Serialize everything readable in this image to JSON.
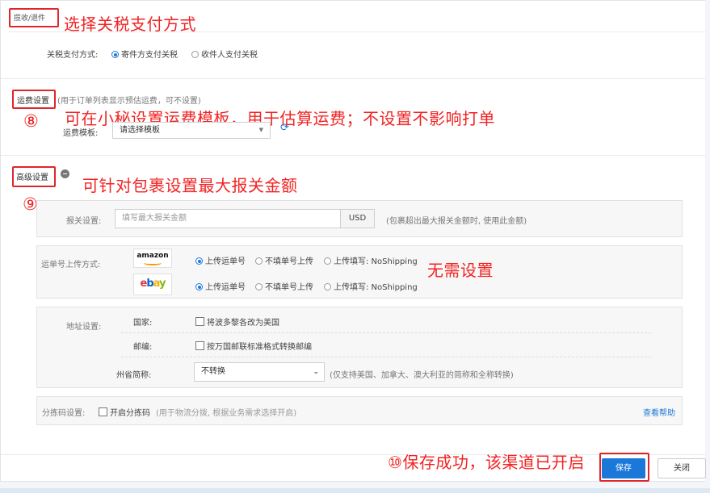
{
  "sections": {
    "tax": {
      "title": "揽收/退件",
      "label": "关税支付方式:",
      "options": [
        "寄件方支付关税",
        "收件人支付关税"
      ],
      "selected": "寄件方支付关税"
    },
    "shipping": {
      "title": "运费设置",
      "note": "(用于订单列表显示预估运费，可不设置)",
      "template_label": "运费模板:",
      "template_placeholder": "请选择模板"
    },
    "advanced": {
      "title": "高级设置",
      "declare": {
        "label": "报关设置:",
        "placeholder": "填写最大报关金额",
        "currency": "USD",
        "hint": "(包裹超出最大报关金额时, 使用此金额)"
      },
      "tracking": {
        "label": "运单号上传方式:",
        "platforms": [
          {
            "name": "amazon",
            "options": [
              "上传运单号",
              "不填单号上传",
              "上传填写: NoShipping"
            ],
            "selected": "上传运单号"
          },
          {
            "name": "ebay",
            "options": [
              "上传运单号",
              "不填单号上传",
              "上传填写: NoShipping"
            ],
            "selected": "上传运单号"
          }
        ]
      },
      "address": {
        "label": "地址设置:",
        "country_label": "国家:",
        "country_option": "将波多黎各改为美国",
        "zip_label": "邮编:",
        "zip_option": "按万国邮联标准格式转换邮编",
        "state_label": "州省简称:",
        "state_value": "不转换",
        "state_hint": "(仅支持美国、加拿大、澳大利亚的简称和全称转换)"
      },
      "sorting": {
        "label": "分拣码设置:",
        "option": "开启分拣码",
        "hint": "(用于物流分拨, 根据业务需求选择开启)",
        "help": "查看帮助"
      }
    }
  },
  "annotations": {
    "tax": "选择关税支付方式",
    "shipping_num": "⑧",
    "shipping": "可在小秘设置运费模板，用于估算运费；不设置不影响打单",
    "advanced_num": "⑨",
    "advanced": "可针对包裹设置最大报关金额",
    "tracking": "无需设置",
    "save": "⑩保存成功，该渠道已开启"
  },
  "footer": {
    "save": "保存",
    "close": "关闭"
  },
  "colors": {
    "primary": "#1b78d9",
    "annotation_red": "#f22323"
  }
}
